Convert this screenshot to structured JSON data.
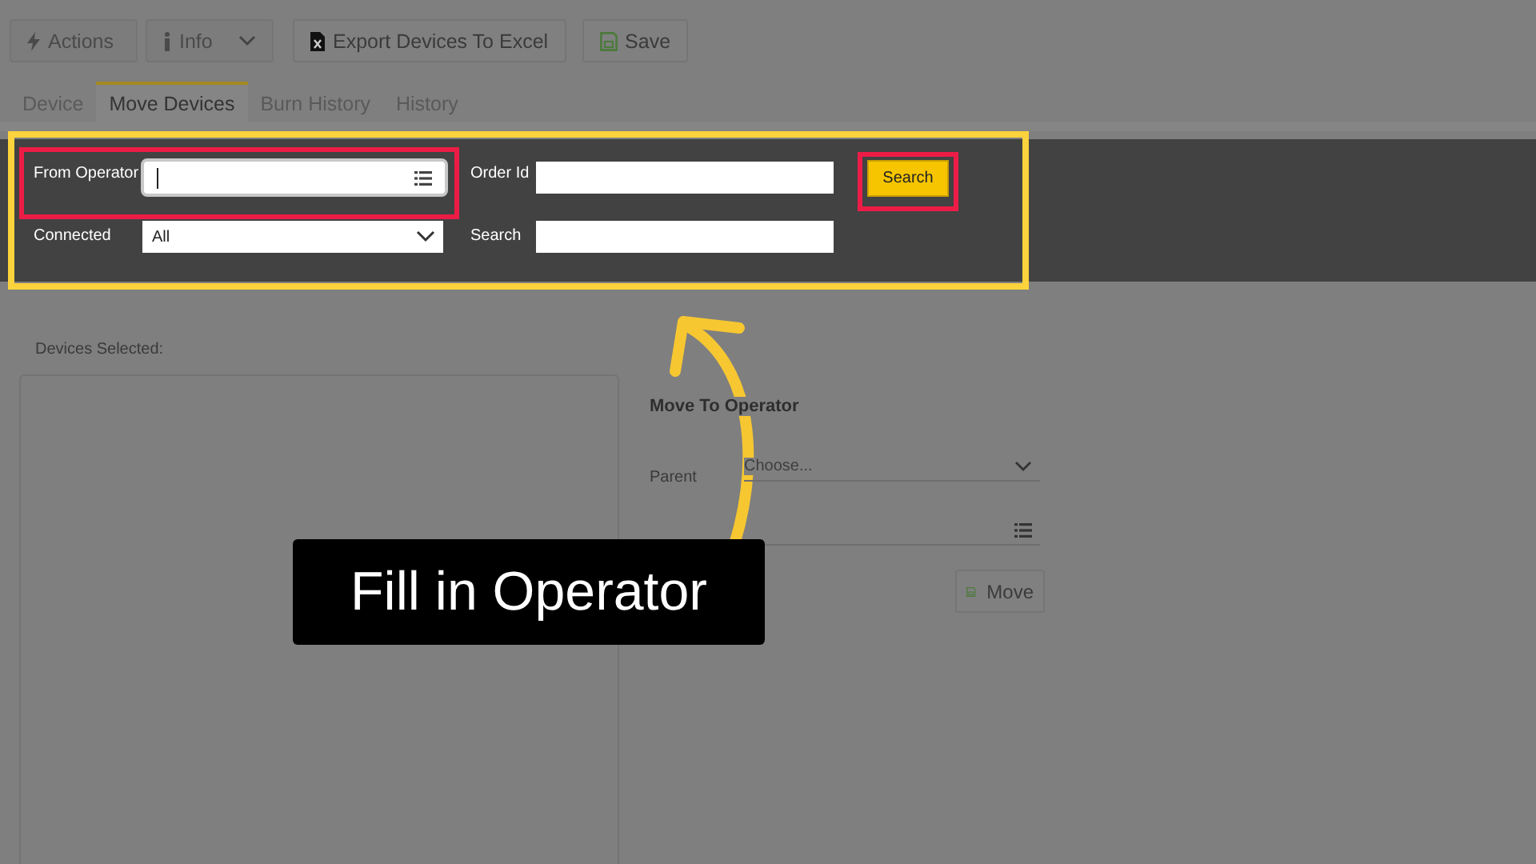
{
  "toolbar": [
    {
      "label": "Actions",
      "kind": "dropdown",
      "disabled": true
    },
    {
      "label": "Info",
      "kind": "dropdown",
      "disabled": true
    },
    {
      "label": "Export Devices To Excel",
      "kind": "excel",
      "disabled": false
    },
    {
      "label": "Save",
      "kind": "save",
      "disabled": false
    }
  ],
  "tabs": [
    {
      "label": "Device",
      "selected": false
    },
    {
      "label": "Move Devices",
      "selected": true
    },
    {
      "label": "Burn History",
      "selected": false
    },
    {
      "label": "History",
      "selected": false
    }
  ],
  "filters": {
    "from_operator": {
      "label": "From Operator"
    },
    "connected": {
      "label": "Connected",
      "value": "All"
    },
    "order_id": {
      "label": "Order Id"
    },
    "search": {
      "label": "Search"
    },
    "search_button": "Search"
  },
  "devices_selected": {
    "label": "Devices Selected:"
  },
  "move_to_operator": {
    "title": "Move To Operator",
    "parent": {
      "label": "Parent",
      "placeholder": "Choose..."
    },
    "move_button": "Move"
  },
  "callout": "Fill in Operator"
}
